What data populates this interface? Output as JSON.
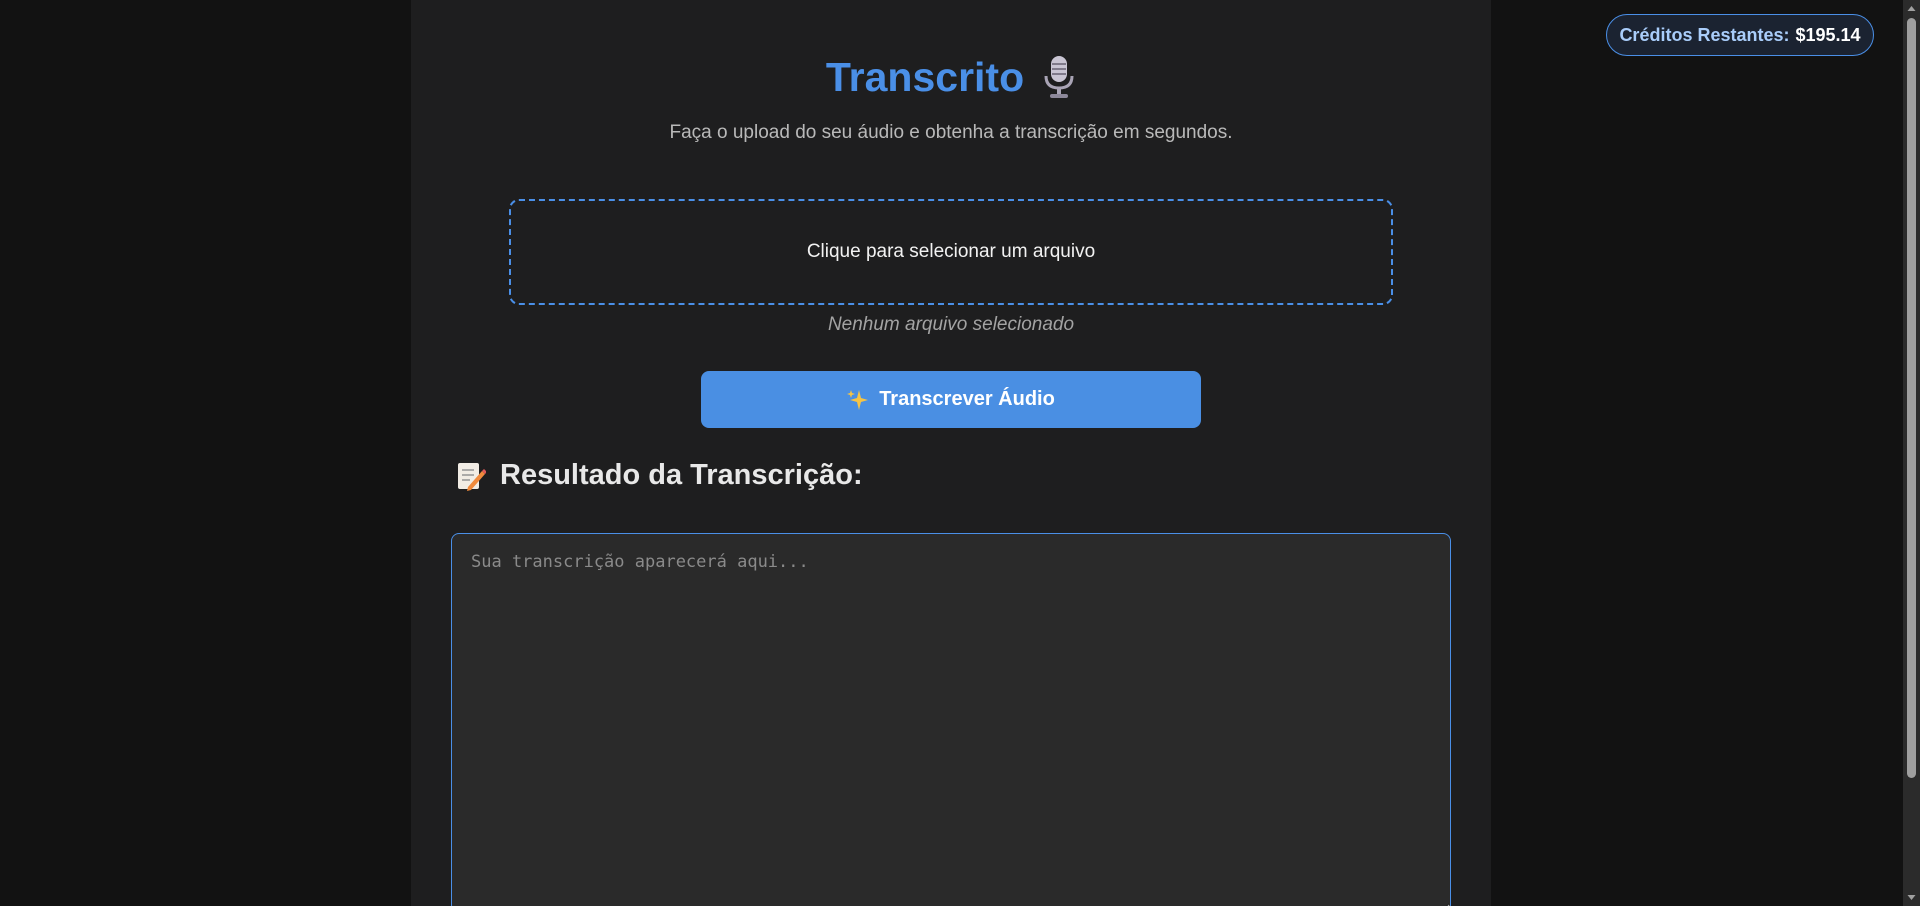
{
  "header": {
    "credits_label": "Créditos Restantes:",
    "credits_value": "$195.14"
  },
  "main": {
    "title": "Transcrito",
    "title_icon": "microphone-icon",
    "subtitle": "Faça o upload do seu áudio e obtenha a transcrição em segundos.",
    "upload_prompt": "Clique para selecionar um arquivo",
    "file_status": "Nenhum arquivo selecionado",
    "transcribe_button": {
      "icon": "sparkles-icon",
      "label": "Transcrever Áudio"
    },
    "result": {
      "icon": "memo-icon",
      "title": "Resultado da Transcrição:",
      "placeholder": "Sua transcrição aparecerá aqui...",
      "value": ""
    }
  },
  "colors": {
    "accent": "#4a8fe7",
    "background": "#121212",
    "card": "#1e1e1f",
    "textarea": "#2a2a2a"
  }
}
